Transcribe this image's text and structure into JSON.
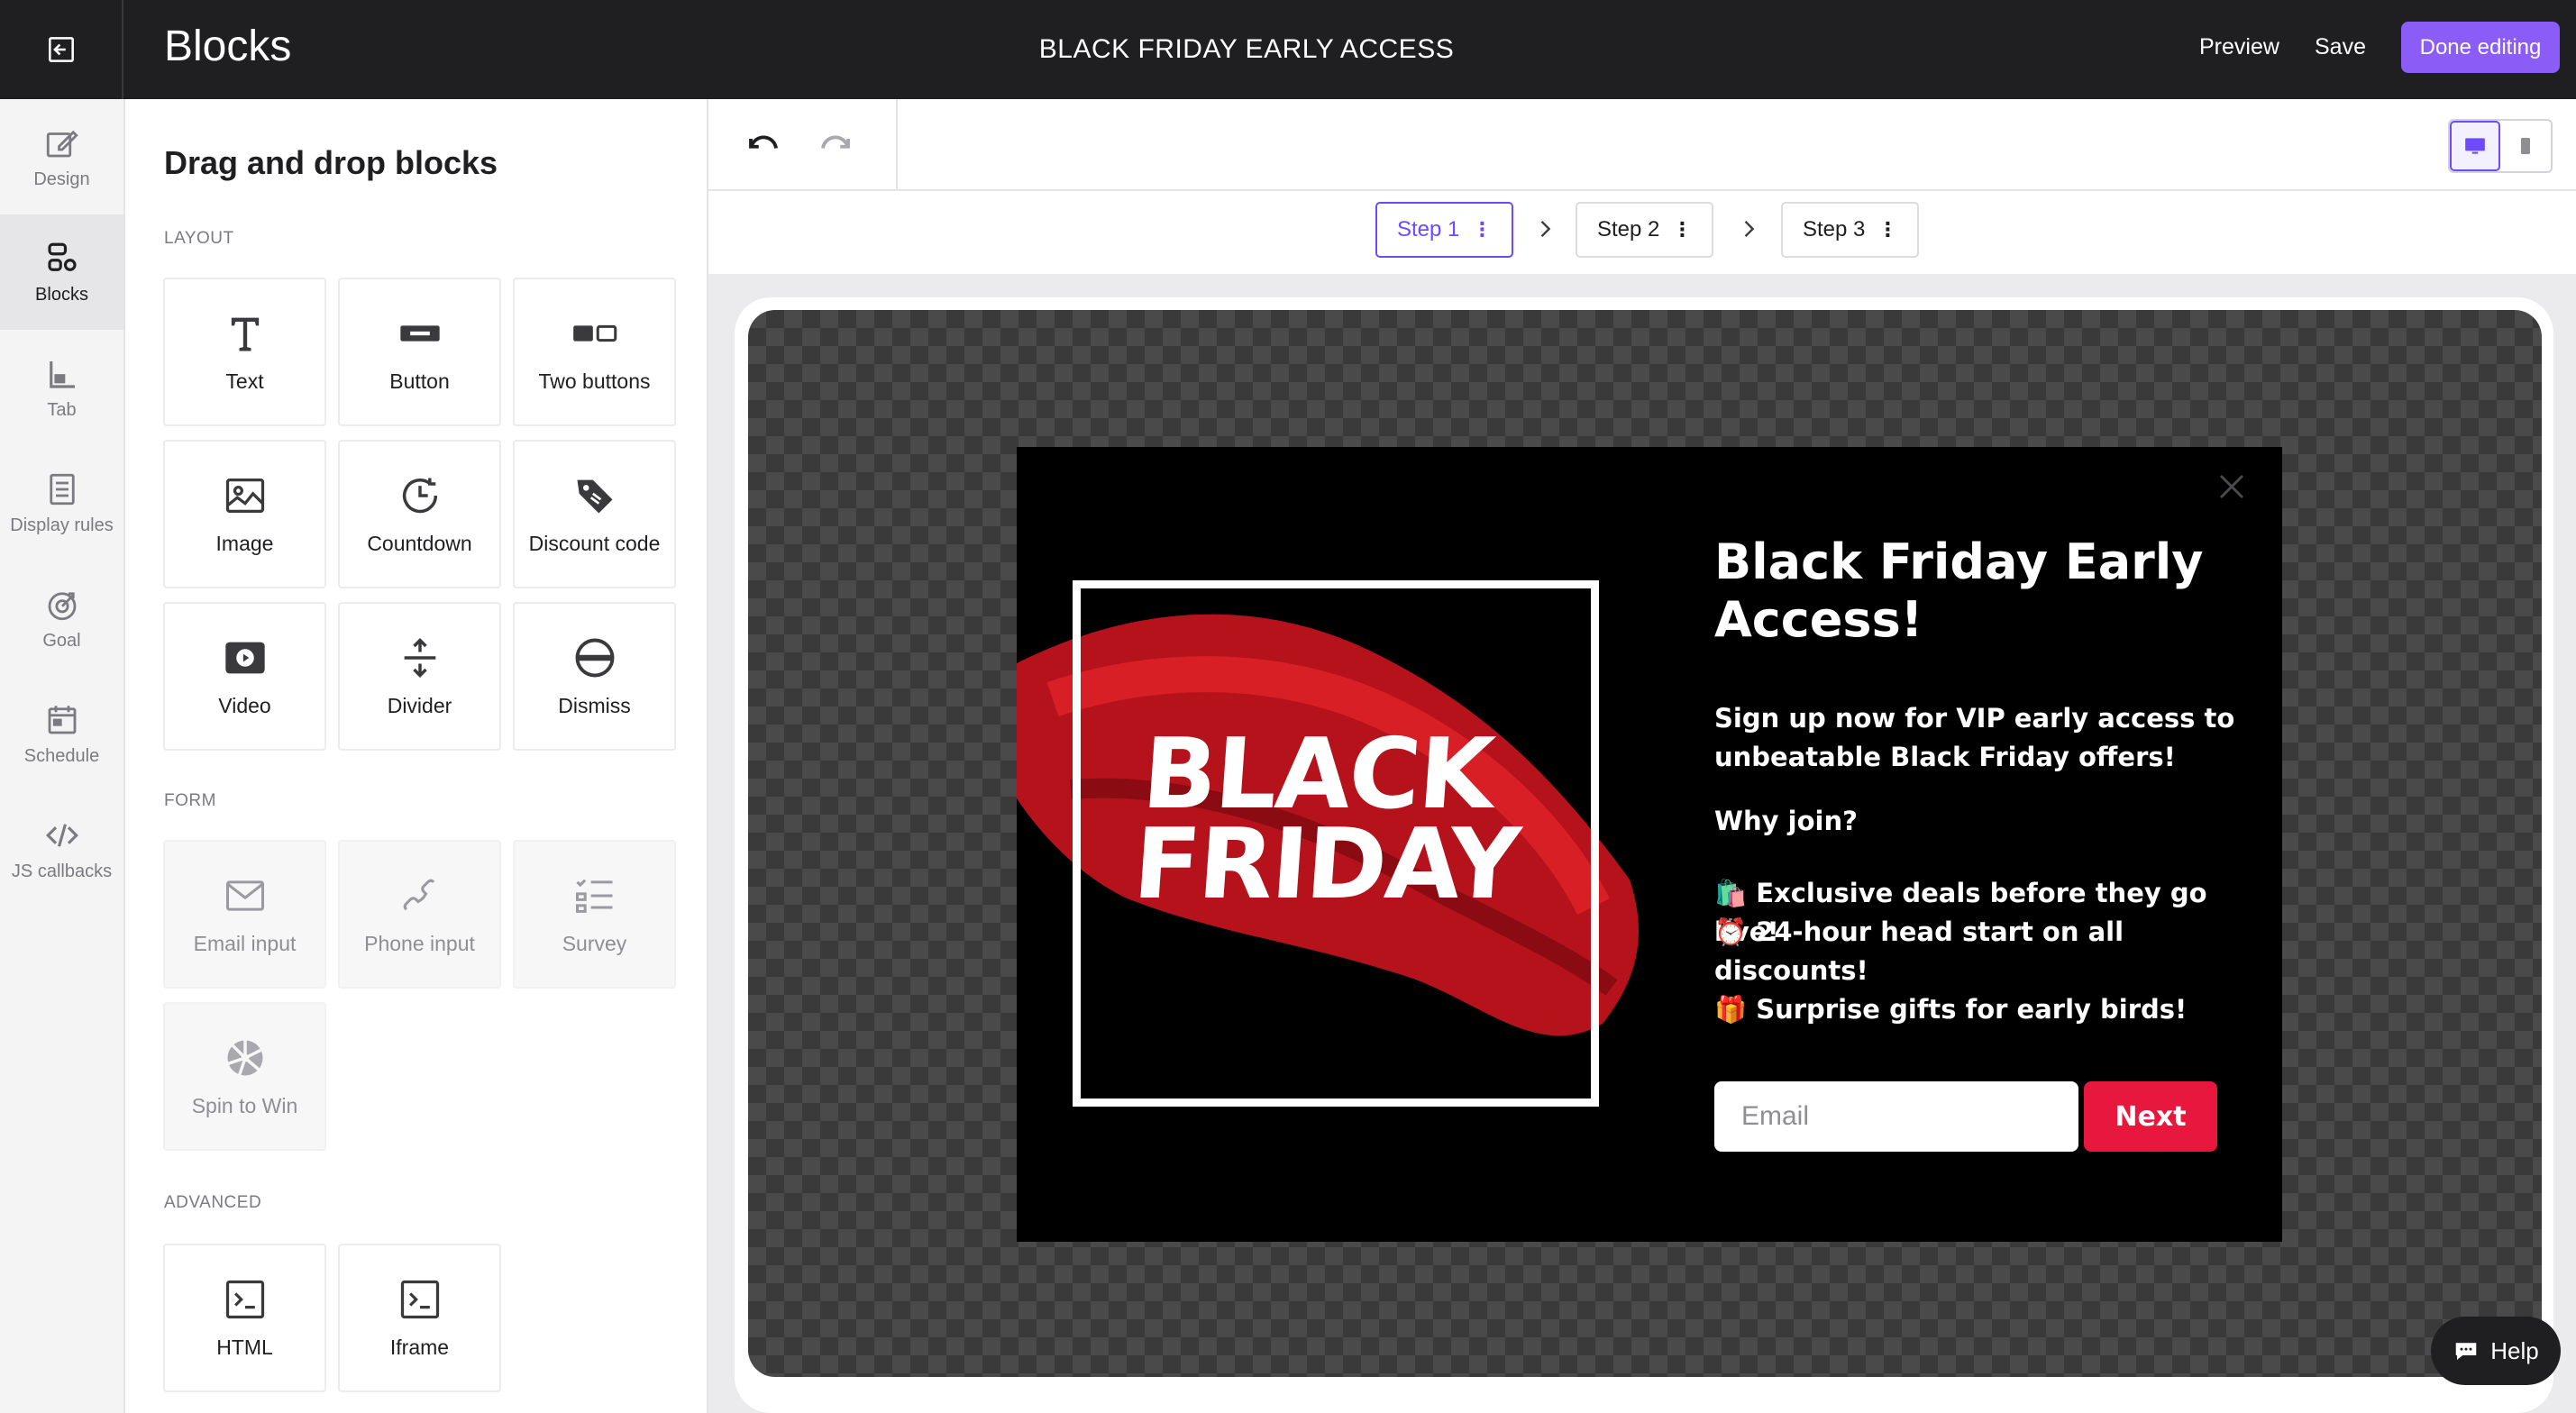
{
  "topbar": {
    "app_title": "Blocks",
    "campaign_title": "BLACK FRIDAY EARLY ACCESS",
    "preview_label": "Preview",
    "save_label": "Save",
    "done_label": "Done editing",
    "accent_color": "#8b5cf6"
  },
  "rail": {
    "items": [
      {
        "label": "Design",
        "icon": "pen-icon"
      },
      {
        "label": "Blocks",
        "icon": "blocks-icon",
        "active": true
      },
      {
        "label": "Tab",
        "icon": "tab-icon"
      },
      {
        "label": "Display rules",
        "icon": "rules-icon"
      },
      {
        "label": "Goal",
        "icon": "target-icon"
      },
      {
        "label": "Schedule",
        "icon": "calendar-icon"
      },
      {
        "label": "JS callbacks",
        "icon": "code-icon"
      }
    ]
  },
  "panel": {
    "title": "Drag and drop blocks",
    "sections": {
      "layout": "LAYOUT",
      "form": "FORM",
      "advanced": "ADVANCED"
    },
    "layout_blocks": [
      "Text",
      "Button",
      "Two buttons",
      "Image",
      "Countdown",
      "Discount code",
      "Video",
      "Divider",
      "Dismiss"
    ],
    "form_blocks": [
      "Email input",
      "Phone input",
      "Survey",
      "Spin to Win"
    ],
    "advanced_blocks": [
      "HTML",
      "Iframe"
    ]
  },
  "steps": [
    "Step 1",
    "Step 2",
    "Step 3"
  ],
  "popup": {
    "art_line1": "BLACK",
    "art_line2": "FRIDAY",
    "title": "Black Friday Early Access!",
    "subtitle": "Sign up now for VIP early access to unbeatable Black Friday offers!",
    "why": "Why join?",
    "benefits": [
      "🛍️ Exclusive deals before they go live!",
      "⏰ 24-hour head start on all discounts!",
      "🎁 Surprise gifts for early birds!"
    ],
    "email_placeholder": "Email",
    "next_label": "Next",
    "button_color": "#e8173d"
  },
  "help_label": "Help"
}
